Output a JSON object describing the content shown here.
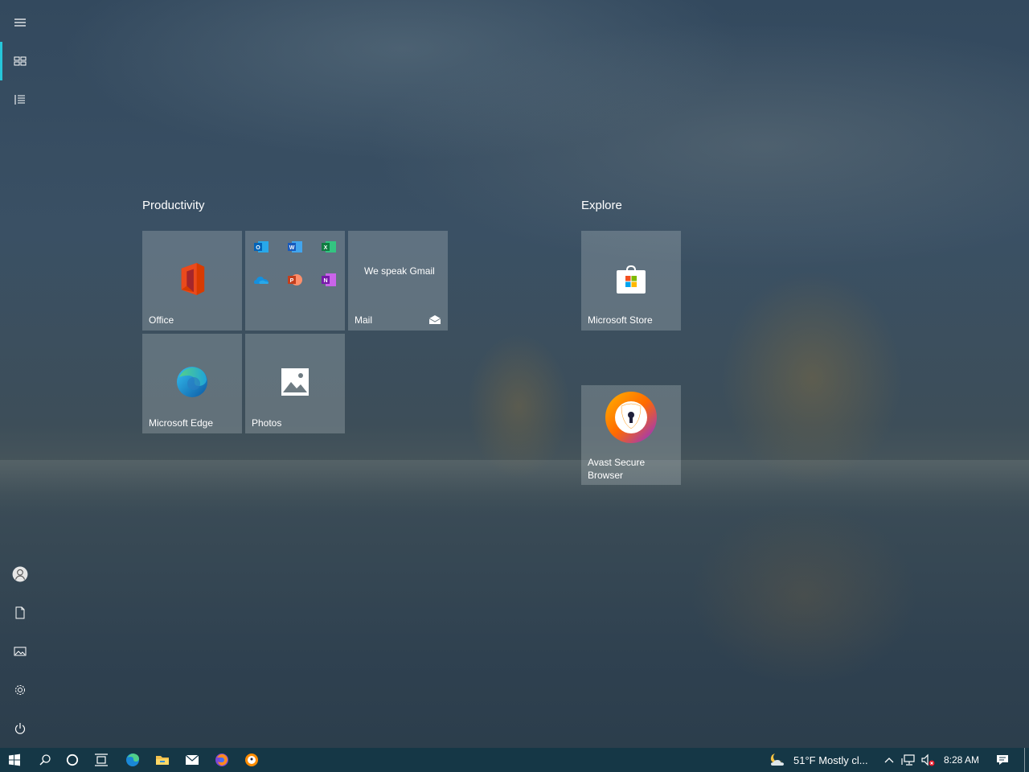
{
  "groups": [
    {
      "title": "Productivity"
    },
    {
      "title": "Explore"
    }
  ],
  "tiles": {
    "office": {
      "label": "Office"
    },
    "mail": {
      "label": "Mail",
      "live_text": "We speak Gmail"
    },
    "edge": {
      "label": "Microsoft Edge"
    },
    "photos": {
      "label": "Photos"
    },
    "store": {
      "label": "Microsoft Store"
    },
    "avast": {
      "label": "Avast Secure Browser"
    }
  },
  "office_folder_apps": [
    "outlook-icon",
    "word-icon",
    "excel-icon",
    "onedrive-icon",
    "powerpoint-icon",
    "onenote-icon"
  ],
  "left_rail": [
    "hamburger-menu",
    "pinned-tiles",
    "all-apps",
    "account",
    "documents",
    "pictures",
    "settings",
    "power"
  ],
  "taskbar": {
    "weather_text": "51°F  Mostly cl...",
    "time": "8:28 AM"
  },
  "colors": {
    "accent": "#26c6da",
    "taskbar": "#14374a",
    "tile": "#b9c3c8"
  }
}
